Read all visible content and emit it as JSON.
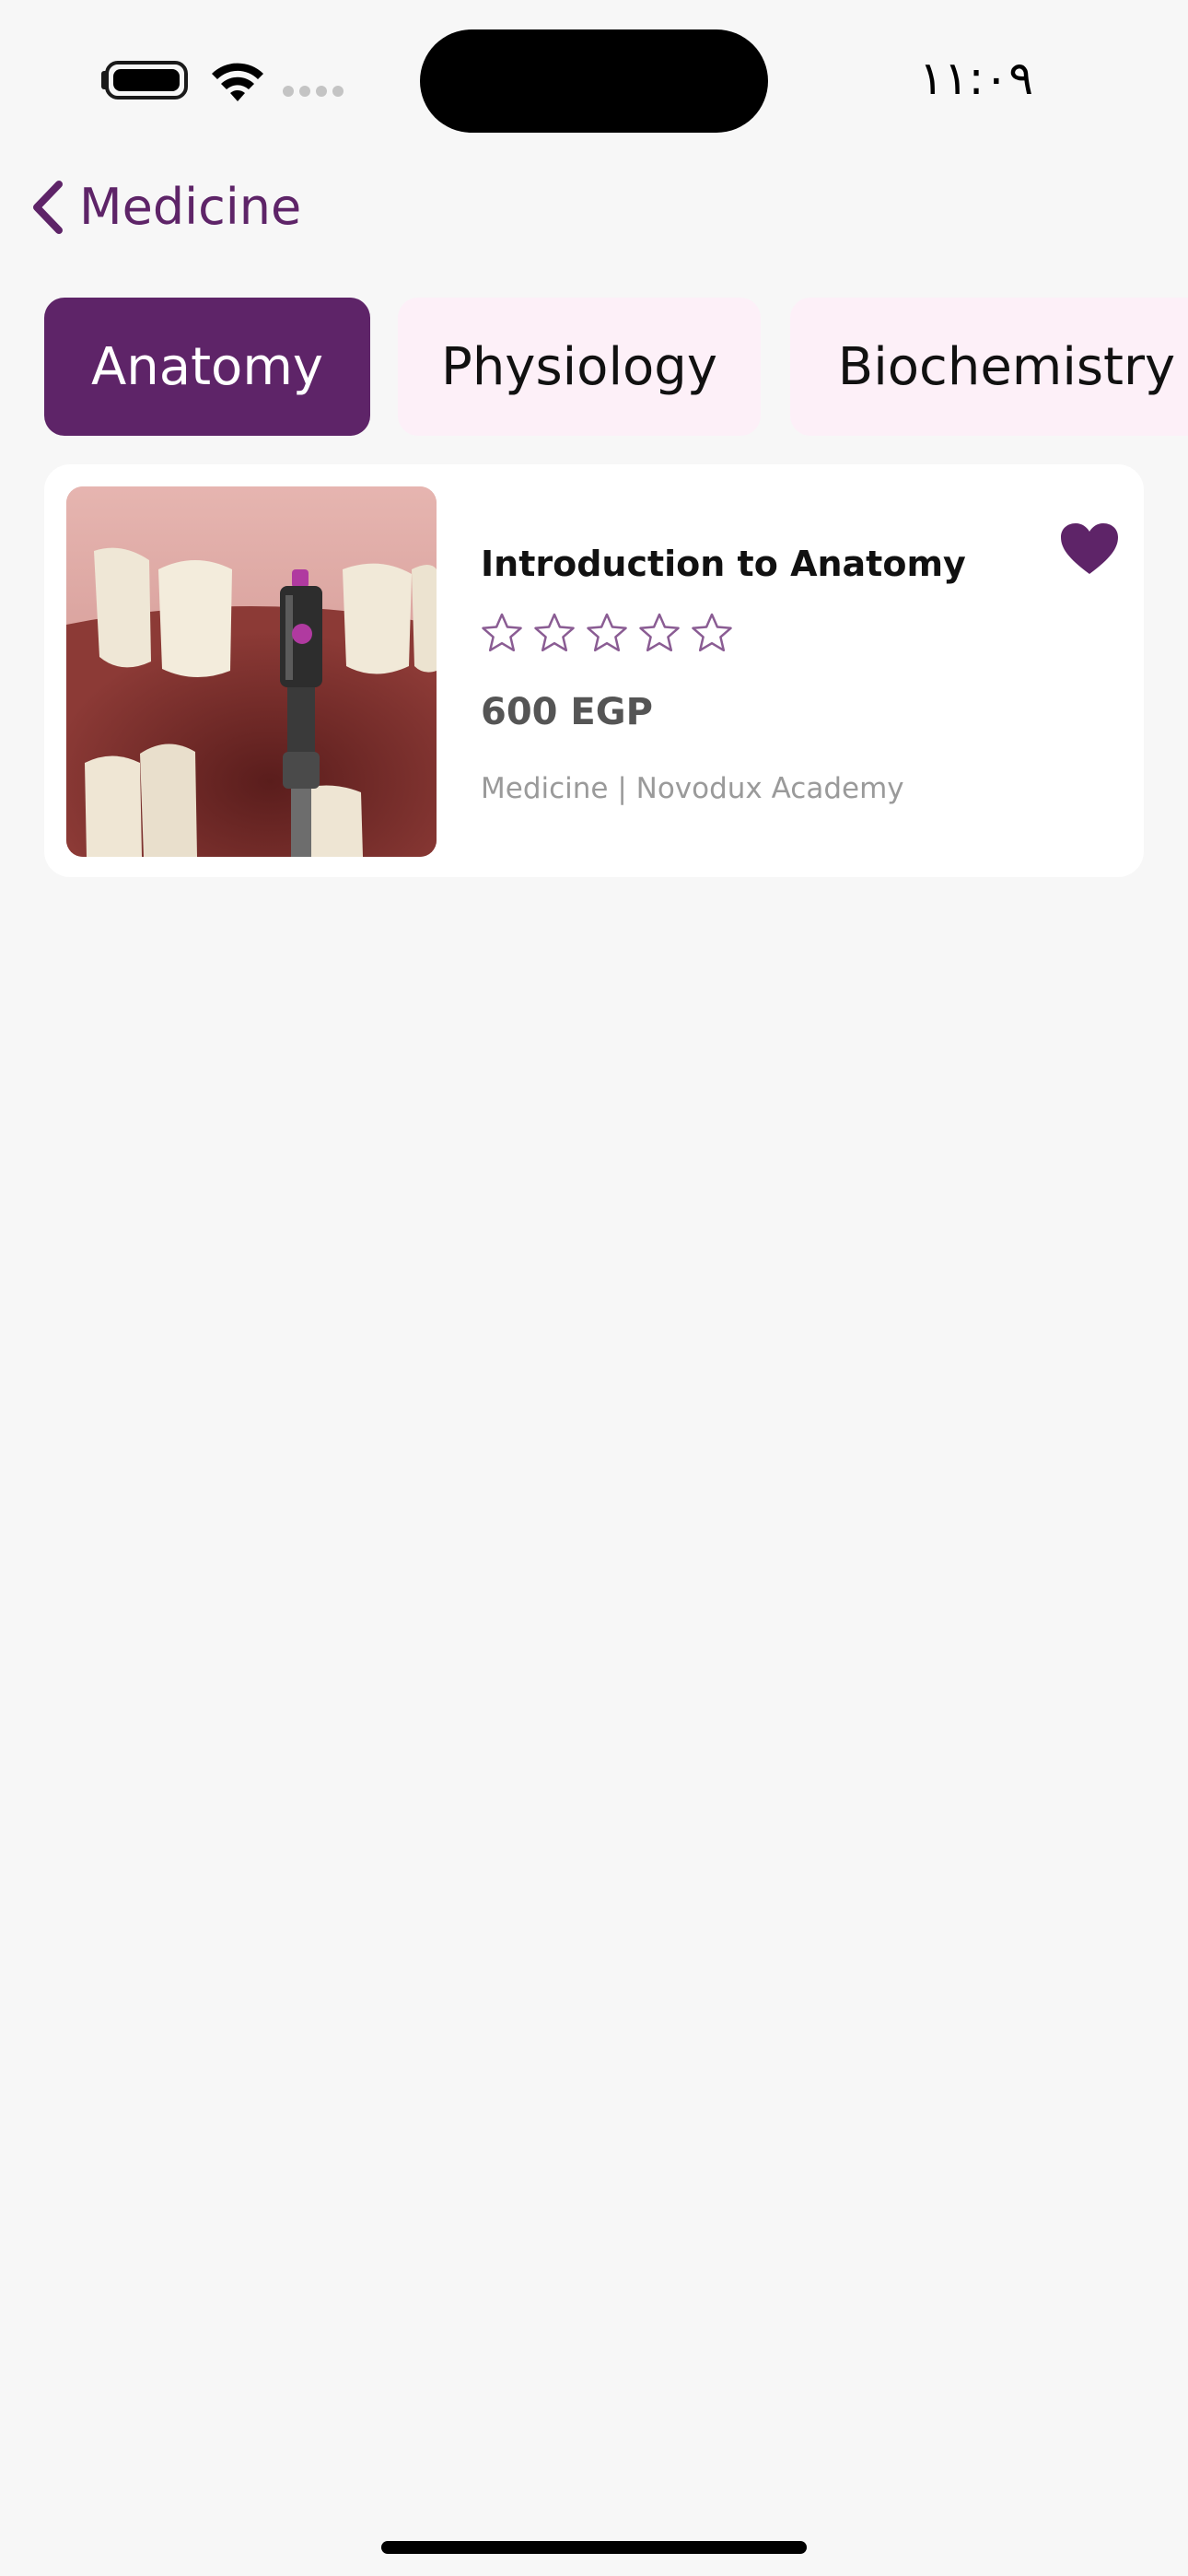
{
  "status_bar": {
    "time": "١١:٠٩",
    "icons": [
      "battery-icon",
      "wifi-icon",
      "cellular-signal-icon"
    ]
  },
  "nav": {
    "back_icon": "chevron-left-icon",
    "title": "Medicine"
  },
  "tabs": [
    {
      "label": "Anatomy",
      "active": true
    },
    {
      "label": "Physiology",
      "active": false
    },
    {
      "label": "Biochemistry",
      "active": false
    }
  ],
  "courses": [
    {
      "title": "Introduction to Anatomy",
      "rating": 0,
      "max_rating": 5,
      "price": "600 EGP",
      "meta": "Medicine | Novodux Academy",
      "favorite": true,
      "image": "dental-implant-photo"
    }
  ],
  "colors": {
    "brand": "#5e2468",
    "tab_inactive_bg": "#fdf0f8",
    "background": "#f7f7f7",
    "star_outline": "#8a5c93"
  }
}
